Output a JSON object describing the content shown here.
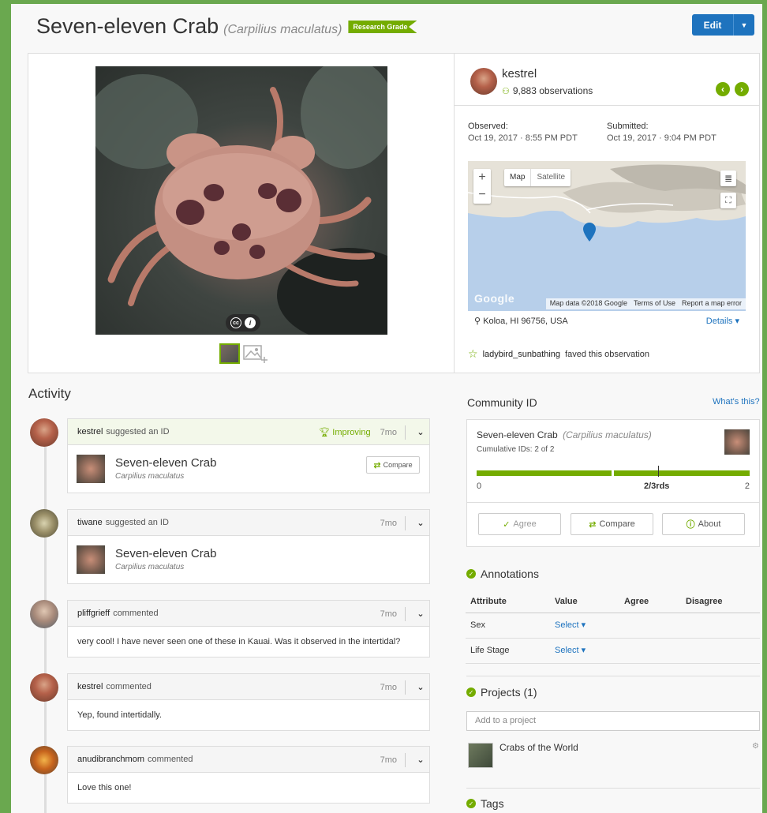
{
  "header": {
    "common_name": "Seven-eleven Crab",
    "scientific_name": "(Carpilius maculatus)",
    "badge": "Research Grade",
    "edit_label": "Edit"
  },
  "observer": {
    "username": "kestrel",
    "observations": "9,883 observations"
  },
  "dates": {
    "observed_label": "Observed:",
    "observed_value": "Oct 19, 2017 · 8:55 PM PDT",
    "submitted_label": "Submitted:",
    "submitted_value": "Oct 19, 2017 · 9:04 PM PDT"
  },
  "map": {
    "type_map": "Map",
    "type_satellite": "Satellite",
    "zoom_in": "+",
    "zoom_out": "−",
    "logo": "Google",
    "attribution": [
      "Map data ©2018 Google",
      "Terms of Use",
      "Report a map error"
    ],
    "location": "Koloa, HI 96756, USA",
    "details": "Details ▾"
  },
  "faved": {
    "user": "ladybird_sunbathing",
    "text": "faved this observation"
  },
  "activity": {
    "title": "Activity",
    "items": [
      {
        "user": "kestrel",
        "action": "suggested an ID",
        "badge": "Improving",
        "ago": "7mo",
        "name": "Seven-eleven Crab",
        "sci": "Carpilius maculatus",
        "compare": "Compare"
      },
      {
        "user": "tiwane",
        "action": "suggested an ID",
        "ago": "7mo",
        "name": "Seven-eleven Crab",
        "sci": "Carpilius maculatus"
      },
      {
        "user": "pliffgrieff",
        "action": "commented",
        "ago": "7mo",
        "body": "very cool! I have never seen one of these in Kauai. Was it observed in the intertidal?"
      },
      {
        "user": "kestrel",
        "action": "commented",
        "ago": "7mo",
        "body": "Yep, found intertidally."
      },
      {
        "user": "anudibranchmom",
        "action": "commented",
        "ago": "7mo",
        "body": "Love this one!"
      }
    ]
  },
  "community": {
    "title": "Community ID",
    "whats_this": "What's this?",
    "name": "Seven-eleven Crab",
    "sci": "(Carpilius maculatus)",
    "cumulative": "Cumulative IDs: 2 of 2",
    "scale_min": "0",
    "scale_mid": "2/3rds",
    "scale_max": "2",
    "cumulative_fraction": 1.0,
    "agree": "Agree",
    "compare": "Compare",
    "about": "About"
  },
  "annotations": {
    "title": "Annotations",
    "headers": [
      "Attribute",
      "Value",
      "Agree",
      "Disagree"
    ],
    "rows": [
      {
        "attribute": "Sex",
        "value": "Select ▾"
      },
      {
        "attribute": "Life Stage",
        "value": "Select ▾"
      }
    ]
  },
  "projects": {
    "title": "Projects (1)",
    "placeholder": "Add to a project",
    "items": [
      {
        "name": "Crabs of the World"
      }
    ]
  },
  "tags": {
    "title": "Tags"
  },
  "colors": {
    "accent": "#74ac00",
    "link": "#1e73be",
    "frame": "#6aa84f"
  }
}
